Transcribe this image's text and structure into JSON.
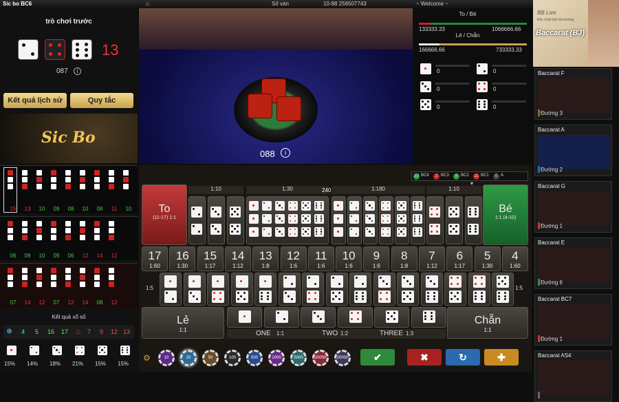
{
  "topbar": {
    "title": "Sic bo BC6",
    "round_label": "Số ván",
    "round_value": "10-88 256507743",
    "welcome": "~ Welcome ~"
  },
  "left": {
    "prev_title": "trò chơi trước",
    "total": "13",
    "prev_round": "087",
    "btn_history": "Kết quả lịch sử",
    "btn_rules": "Quy tắc",
    "logo": "Sic Bo",
    "grid1_numbers": [
      "15",
      "13",
      "10",
      "09",
      "08",
      "10",
      "08",
      "11",
      "10"
    ],
    "grid2_numbers": [
      "06",
      "09",
      "10",
      "09",
      "06",
      "12",
      "14",
      "12"
    ],
    "grid3_numbers": [
      "07",
      "14",
      "12",
      "07",
      "12",
      "14",
      "08",
      "12"
    ],
    "lottery_title": "Kết quả xổ số",
    "lottery_nums": [
      "4",
      "5",
      "16",
      "17",
      "7",
      "9",
      "12",
      "13"
    ],
    "pct": [
      "15%",
      "14%",
      "18%",
      "21%",
      "15%",
      "15%"
    ]
  },
  "video": {
    "round": "088"
  },
  "stats": {
    "big_small_label": "To / Bé",
    "big_val": "133333.33",
    "small_val": "1066666.66",
    "odd_even_label": "Lẻ / Chẵn",
    "odd_val": "166666.66",
    "even_val": "733333.33",
    "face_counts": [
      "0",
      "0",
      "0",
      "0",
      "0",
      "0"
    ]
  },
  "ad": {
    "brand": "BB Live",
    "tagline": "Độc nhất trên thị trường",
    "game": "Baccarat (BJ)"
  },
  "side": [
    {
      "name": "Baccarat F",
      "road": "Đường 3"
    },
    {
      "name": "Baccarat A",
      "road": "Đường 2"
    },
    {
      "name": "Baccarat G",
      "road": "Đường 1"
    },
    {
      "name": "Baccarat E",
      "road": "Đường 6"
    },
    {
      "name": "Baccarat BC7",
      "road": "Đường 1"
    },
    {
      "name": "Baccarat AS4",
      "road": ""
    }
  ],
  "table": {
    "room_tags": [
      "10",
      "BC4",
      "2",
      "BC3",
      "9",
      "BC2",
      "11",
      "BC1",
      "0",
      "A"
    ],
    "odds_1_10": "1:10",
    "odds_1_30": "1:30",
    "odds_1_180": "1:180",
    "odds_right": "1:10",
    "timer": "240",
    "big": "To",
    "big_range": "(11-17) 1:1",
    "small": "Bé",
    "small_range": "1:1 (4-10)",
    "totals": [
      {
        "n": "17",
        "o": "1:60"
      },
      {
        "n": "16",
        "o": "1:30"
      },
      {
        "n": "15",
        "o": "1:17"
      },
      {
        "n": "14",
        "o": "1:12"
      },
      {
        "n": "13",
        "o": "1:8"
      },
      {
        "n": "12",
        "o": "1:6"
      },
      {
        "n": "11",
        "o": "1:6"
      },
      {
        "n": "10",
        "o": "1:6"
      },
      {
        "n": "9",
        "o": "1:6"
      },
      {
        "n": "8",
        "o": "1:8"
      },
      {
        "n": "7",
        "o": "1:12"
      },
      {
        "n": "6",
        "o": "1:17"
      },
      {
        "n": "5",
        "o": "1:30"
      },
      {
        "n": "4",
        "o": "1:60"
      }
    ],
    "combo_odds": "1:5",
    "odd": "Lẻ",
    "odd_o": "1:1",
    "even": "Chẵn",
    "even_o": "1:1",
    "one": "ONE",
    "one_o": "1:1",
    "two": "TWO",
    "two_o": "1:2",
    "three": "THREE",
    "three_o": "1:3"
  },
  "chips": [
    "10",
    "20",
    "50",
    "100",
    "500",
    "1000",
    "5000",
    "10000",
    "20000"
  ],
  "actions": {
    "confirm": "✔",
    "cancel": "✖",
    "repeat": "↻",
    "double": "✚"
  },
  "colors": {
    "accent": "#f0c656",
    "big": "#b33",
    "small": "#2a8a3a"
  }
}
